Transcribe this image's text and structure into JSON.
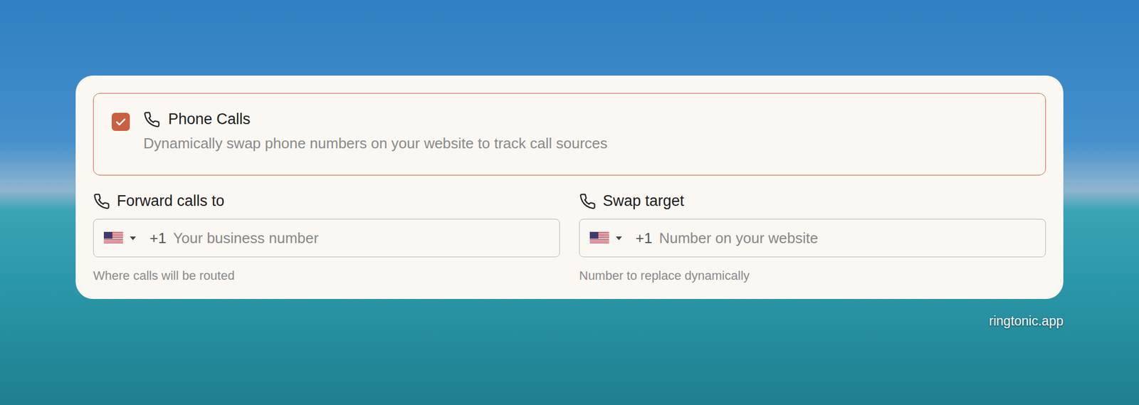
{
  "service": {
    "label": "Phone Calls",
    "description": "Dynamically swap phone numbers on your website to track call sources",
    "checked": true
  },
  "fields": [
    {
      "label": "Forward calls to",
      "country_code": "+1",
      "placeholder": "Your business number",
      "hint": "Where calls will be routed"
    },
    {
      "label": "Swap target",
      "country_code": "+1",
      "placeholder": "Number on your website",
      "hint": "Number to replace dynamically"
    }
  ],
  "watermark": "ringtonic.app"
}
